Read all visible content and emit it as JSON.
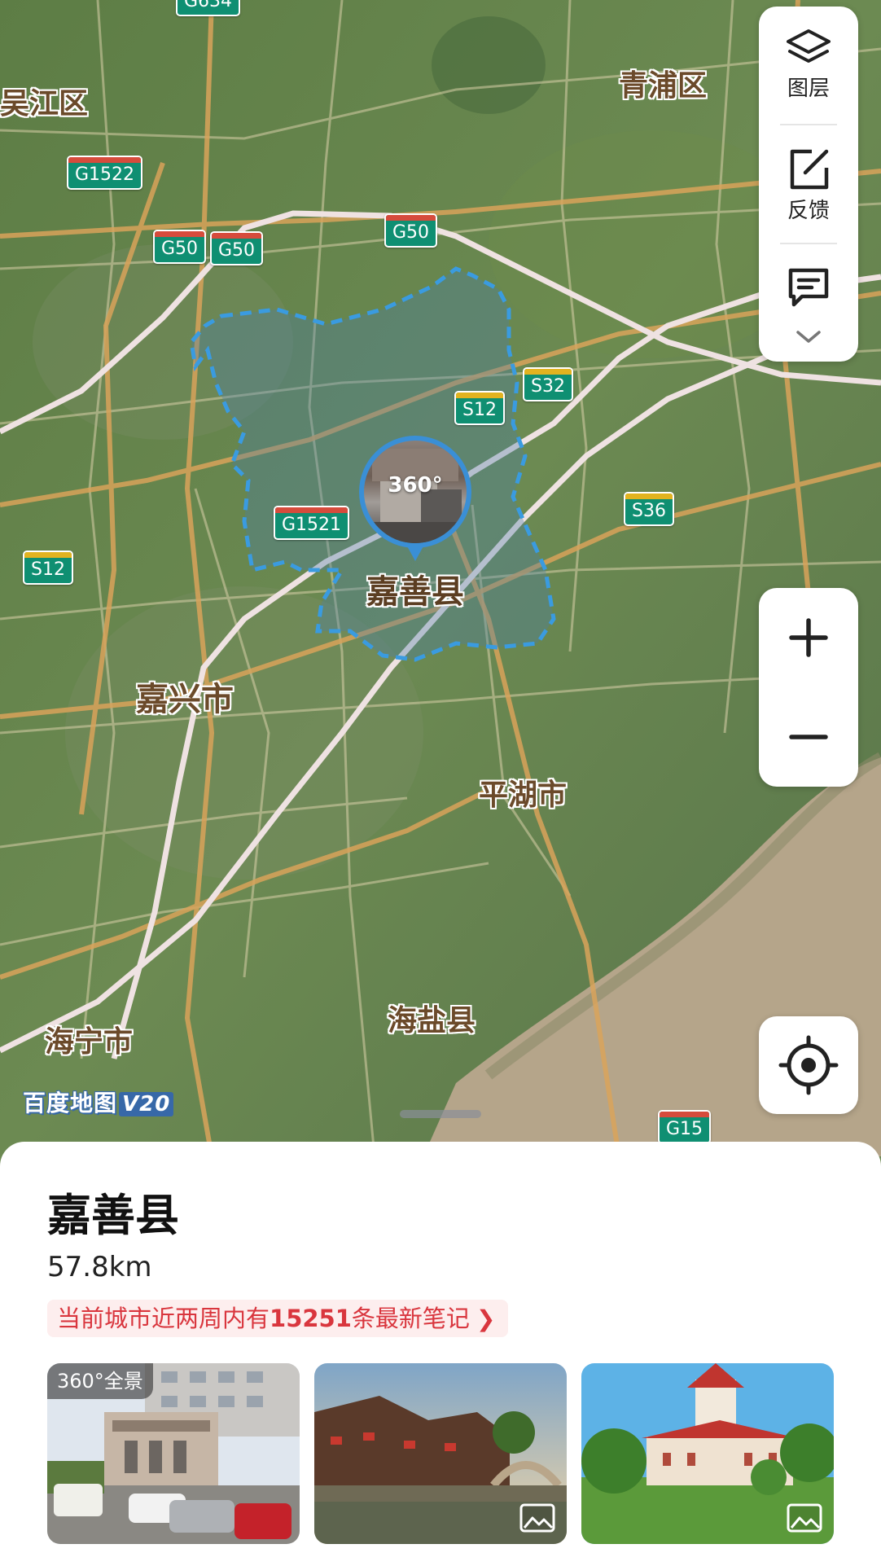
{
  "map": {
    "labels": {
      "wujiang": "吴江区",
      "qingpu": "青浦区",
      "jiaxing": "嘉兴市",
      "pinghu": "平湖市",
      "haining": "海宁市",
      "haiyan": "海盐县",
      "jiashan_selected": "嘉善县"
    },
    "shields": {
      "g634": "G634",
      "g1522": "G1522",
      "g50_a": "G50",
      "g50_b": "G50",
      "g50_c": "G50",
      "s12_a": "S12",
      "s32": "S32",
      "s36": "S36",
      "g1521": "G1521",
      "s12_b": "S12",
      "g15": "G15"
    },
    "pin_label": "360°",
    "watermark": "百度地图",
    "watermark_version": "V20"
  },
  "toolbar": {
    "layers_label": "图层",
    "feedback_label": "反馈",
    "layers_icon": "layers-icon",
    "feedback_icon": "edit-icon",
    "message_icon": "message-icon",
    "expand_icon": "chevron-down-icon"
  },
  "zoom": {
    "in_label": "+",
    "out_label": "−"
  },
  "sheet": {
    "title": "嘉善县",
    "distance": "57.8km",
    "notes_prefix": "当前城市近两周内有",
    "notes_count": "15251",
    "notes_suffix": "条最新笔记",
    "photos": [
      {
        "badge": "360°全景"
      },
      {
        "icon": "image-icon"
      },
      {
        "icon": "image-icon"
      }
    ]
  },
  "colors": {
    "boundary": "#3a9be0",
    "expressway_shield": "#0f8f72",
    "notes_red": "#d9363e"
  }
}
